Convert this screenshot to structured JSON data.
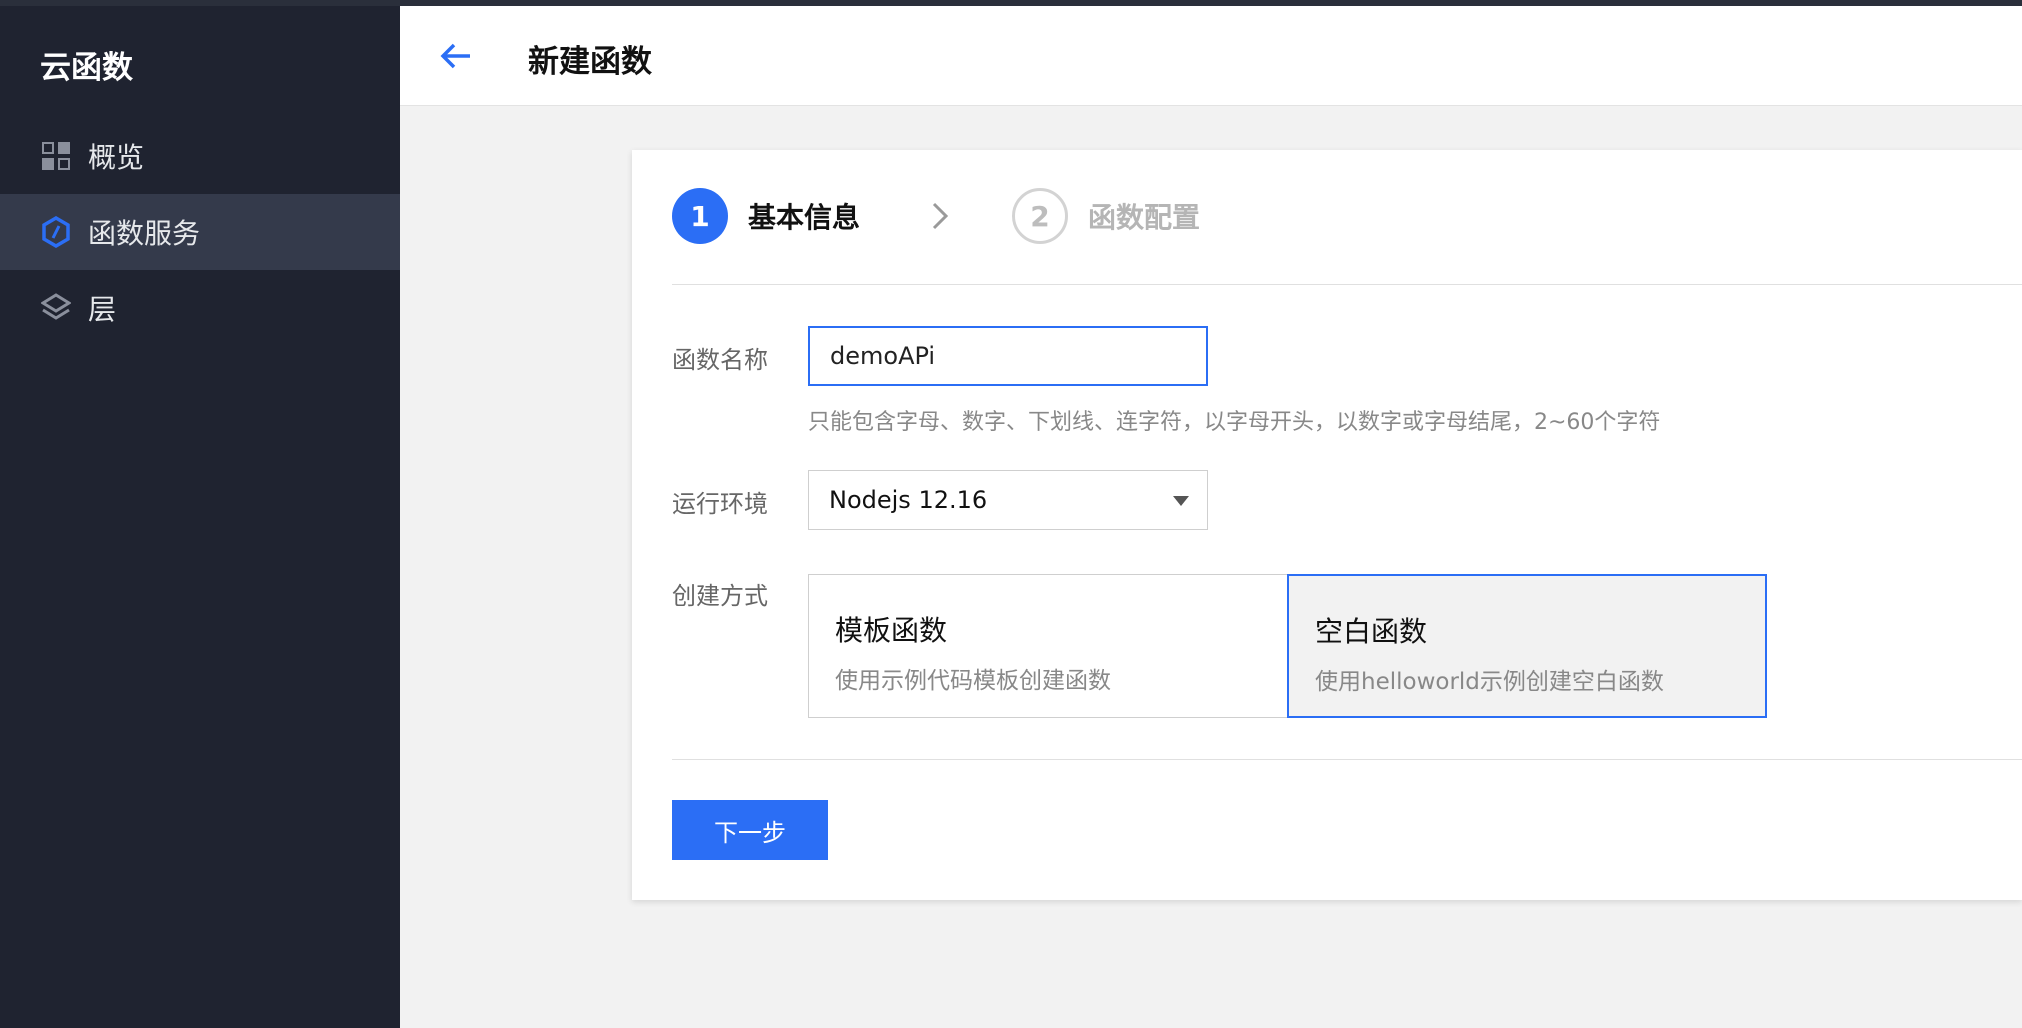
{
  "sidebar": {
    "title": "云函数",
    "items": [
      {
        "label": "概览",
        "icon": "grid-icon",
        "active": false
      },
      {
        "label": "函数服务",
        "icon": "hexagon-icon",
        "active": true
      },
      {
        "label": "层",
        "icon": "layers-icon",
        "active": false
      }
    ]
  },
  "header": {
    "title": "新建函数",
    "back_icon": "arrow-left-icon"
  },
  "steps": [
    {
      "number": "1",
      "label": "基本信息",
      "active": true
    },
    {
      "number": "2",
      "label": "函数配置",
      "active": false
    }
  ],
  "form": {
    "name": {
      "label": "函数名称",
      "value": "demoAPi",
      "hint": "只能包含字母、数字、下划线、连字符，以字母开头，以数字或字母结尾，2~60个字符"
    },
    "env": {
      "label": "运行环境",
      "value": "Nodejs 12.16"
    },
    "mode": {
      "label": "创建方式",
      "options": [
        {
          "title": "模板函数",
          "desc": "使用示例代码模板创建函数",
          "selected": false
        },
        {
          "title": "空白函数",
          "desc": "使用helloworld示例创建空白函数",
          "selected": true
        }
      ]
    }
  },
  "actions": {
    "next_label": "下一步"
  },
  "colors": {
    "accent": "#2b6ef5",
    "sidebar_bg": "#1f2330",
    "sidebar_active": "#343a4b"
  }
}
